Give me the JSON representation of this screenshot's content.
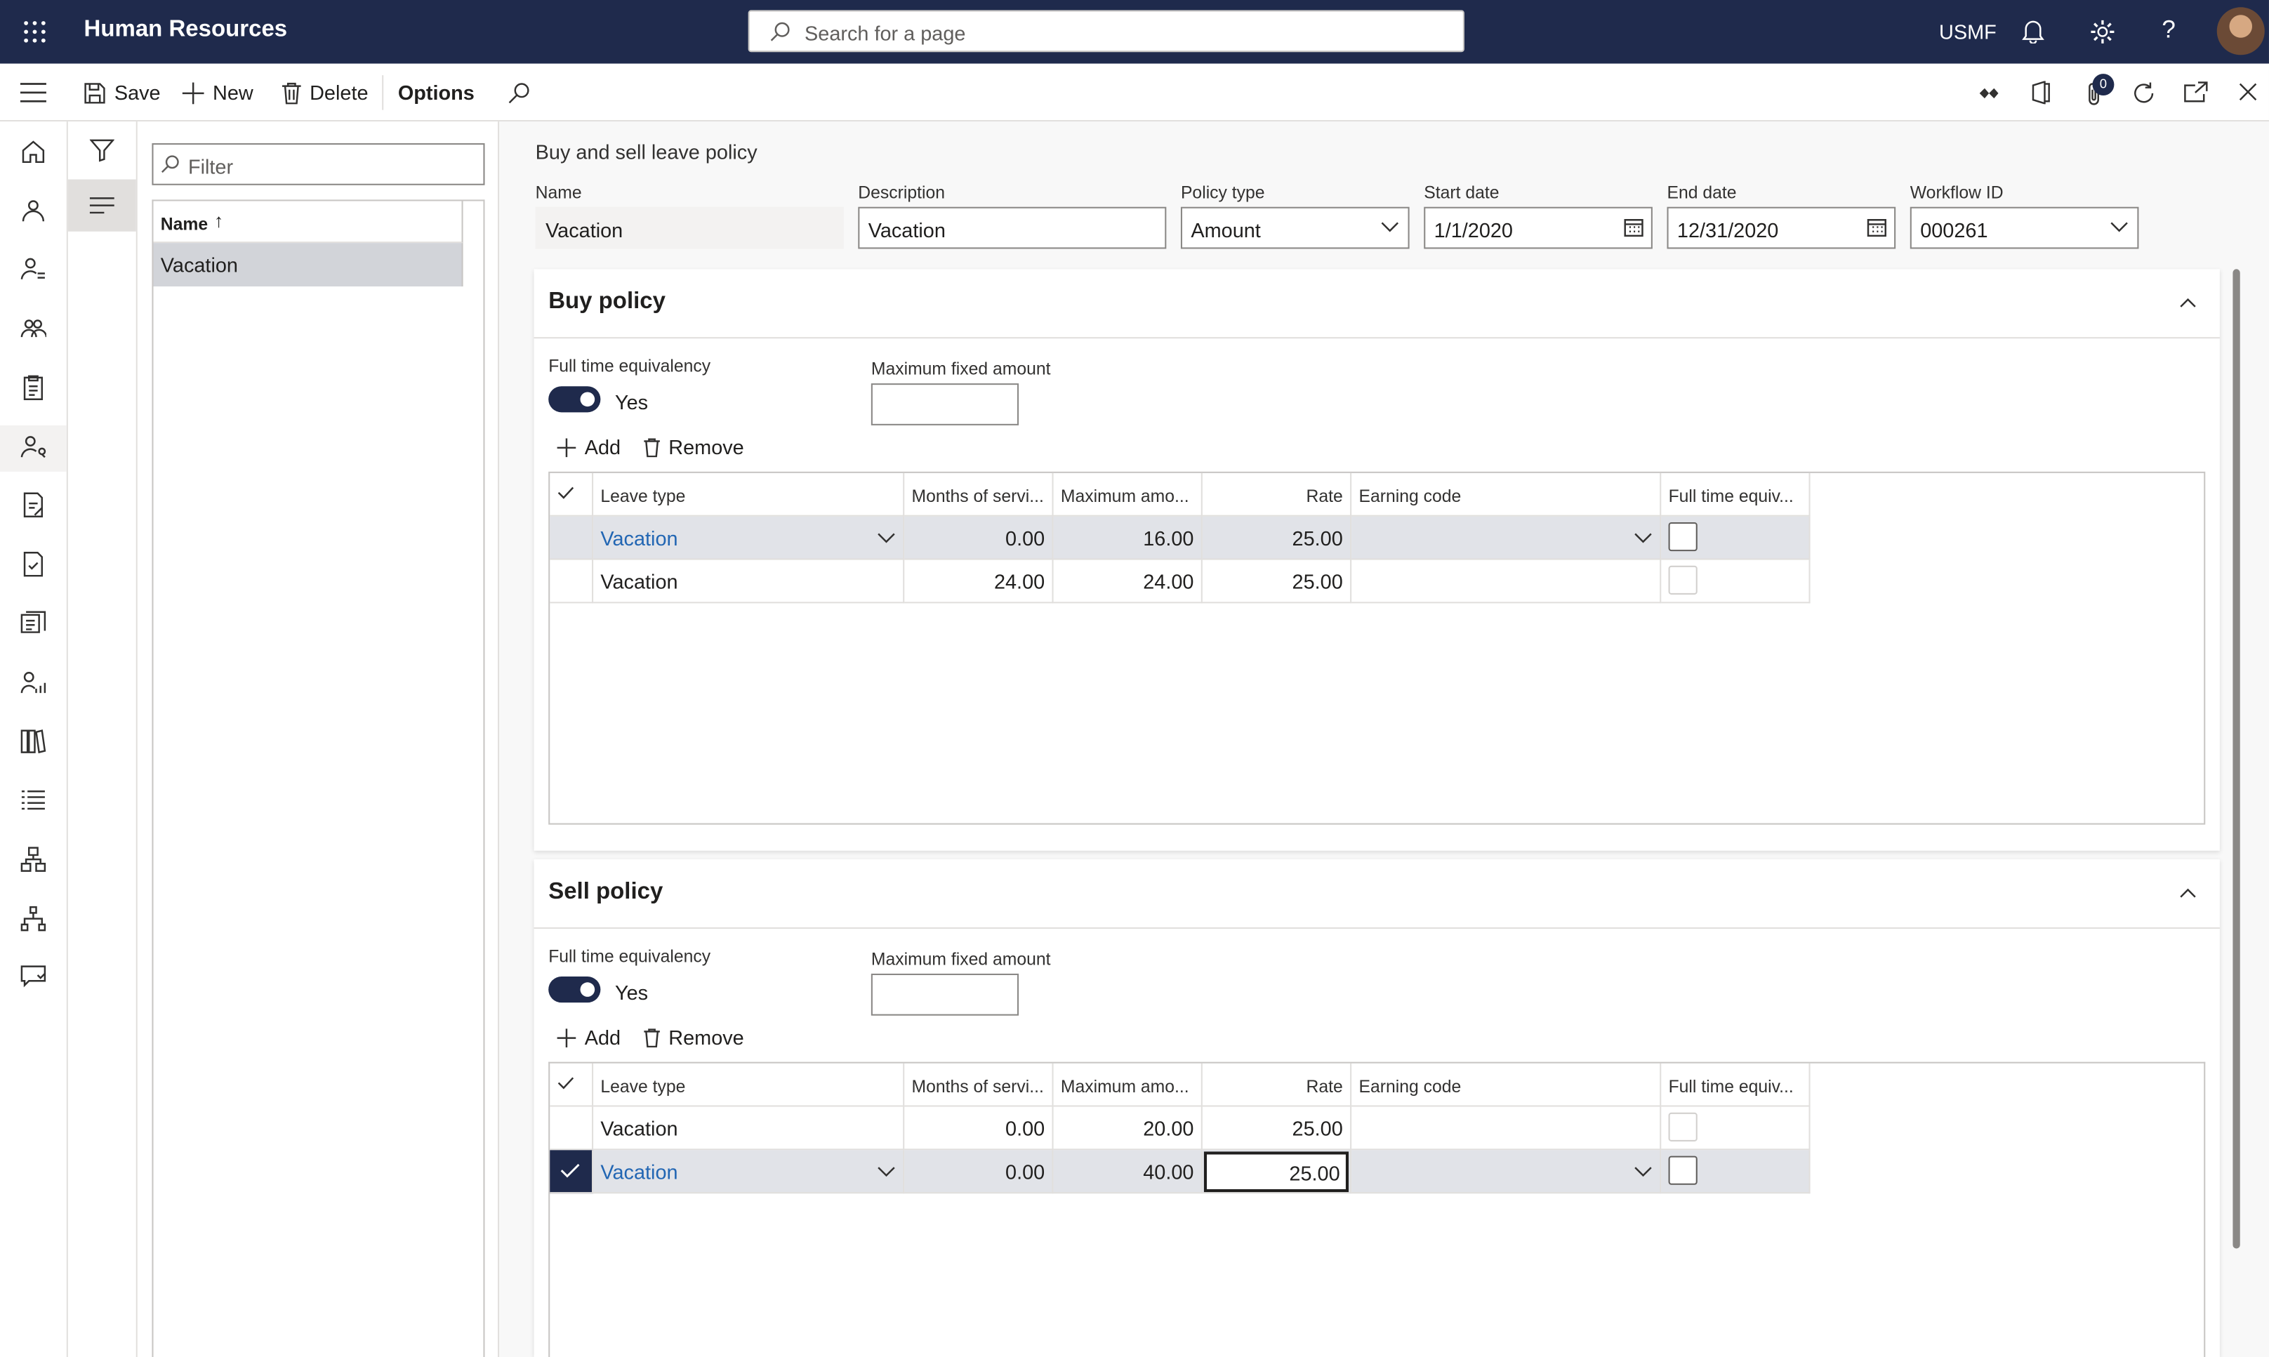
{
  "app": {
    "title": "Human Resources",
    "search_placeholder": "Search for a page",
    "company": "USMF",
    "attachments_count": "0"
  },
  "actions": {
    "save": "Save",
    "new": "New",
    "delete": "Delete",
    "options": "Options"
  },
  "list": {
    "filter_placeholder": "Filter",
    "col_name": "Name",
    "sort_indicator": "↑",
    "items": [
      "Vacation"
    ]
  },
  "form": {
    "title": "Buy and sell leave policy",
    "fields": {
      "name_label": "Name",
      "name": "Vacation",
      "desc_label": "Description",
      "desc": "Vacation",
      "type_label": "Policy type",
      "type": "Amount",
      "start_label": "Start date",
      "start": "1/1/2020",
      "end_label": "End date",
      "end": "12/31/2020",
      "wf_label": "Workflow ID",
      "wf": "000261"
    }
  },
  "columns": {
    "leave": "Leave type",
    "months": "Months of servi...",
    "max": "Maximum amo...",
    "rate": "Rate",
    "earning": "Earning code",
    "fte": "Full time equiv..."
  },
  "buy": {
    "title": "Buy policy",
    "fte_label": "Full time equivalency",
    "fte_value": "Yes",
    "max_label": "Maximum fixed amount",
    "add": "Add",
    "remove": "Remove",
    "rows": [
      {
        "leave": "Vacation",
        "months": "0.00",
        "max": "16.00",
        "rate": "25.00",
        "earning": "",
        "fte": false
      },
      {
        "leave": "Vacation",
        "months": "24.00",
        "max": "24.00",
        "rate": "25.00",
        "earning": "",
        "fte": false
      }
    ]
  },
  "sell": {
    "title": "Sell policy",
    "fte_label": "Full time equivalency",
    "fte_value": "Yes",
    "max_label": "Maximum fixed amount",
    "add": "Add",
    "remove": "Remove",
    "rows": [
      {
        "leave": "Vacation",
        "months": "0.00",
        "max": "20.00",
        "rate": "25.00",
        "earning": "",
        "fte": false
      },
      {
        "leave": "Vacation",
        "months": "0.00",
        "max": "40.00",
        "rate": "25.00",
        "earning": "",
        "fte": false
      }
    ]
  }
}
